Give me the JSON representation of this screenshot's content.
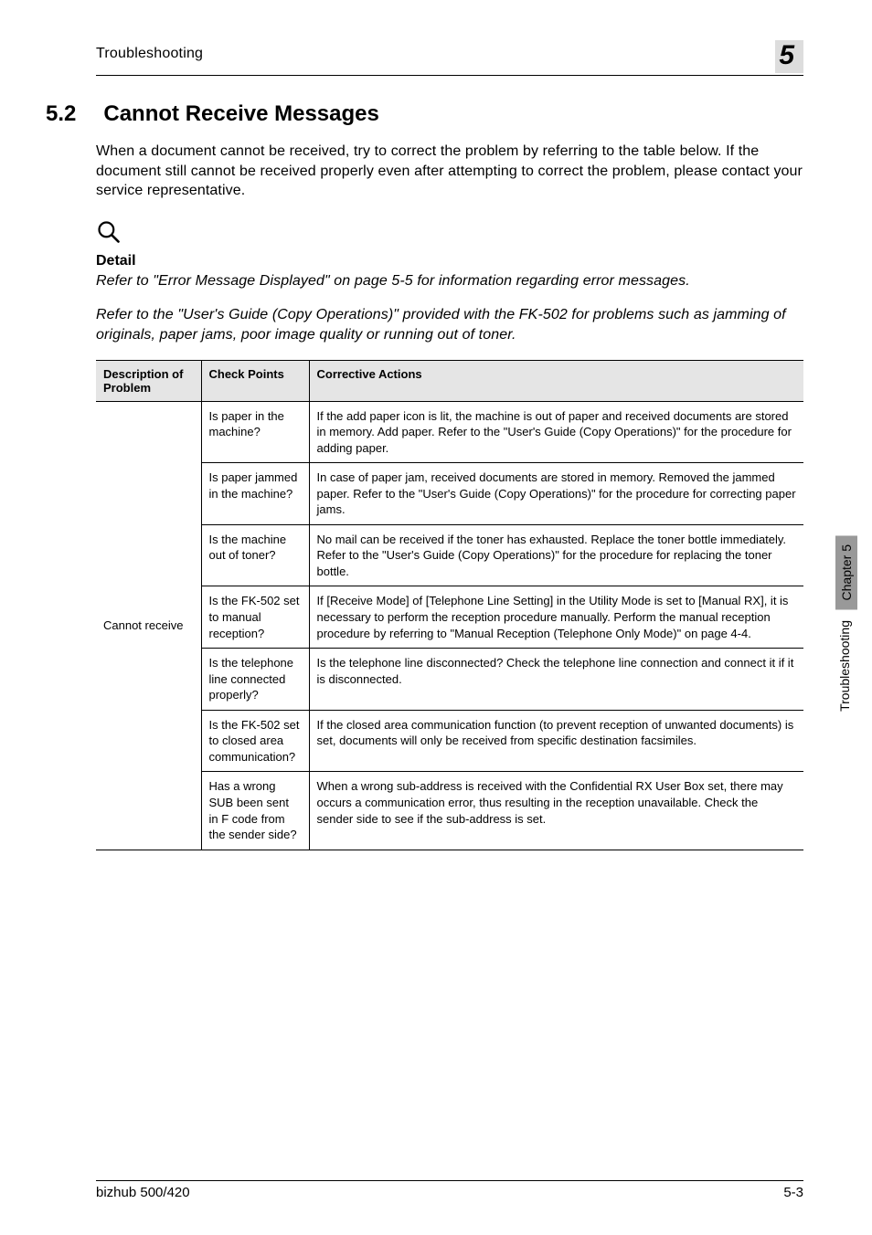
{
  "header": {
    "title": "Troubleshooting",
    "chapter_num": "5"
  },
  "section": {
    "num": "5.2",
    "title": "Cannot Receive Messages"
  },
  "intro": "When a document cannot be received, try to correct the problem by referring to the table below. If the document still cannot be received properly even after attempting to correct the problem, please contact your service representative.",
  "detail": {
    "heading": "Detail",
    "para1": "Refer to \"Error Message Displayed\" on page 5-5 for information regarding error messages.",
    "para2": "Refer to the \"User's Guide (Copy Operations)\" provided with the FK-502 for problems such as jamming of originals, paper jams, poor image quality or running out of toner."
  },
  "table": {
    "headers": {
      "desc": "Description of Problem",
      "check": "Check Points",
      "action": "Corrective Actions"
    },
    "row_desc": "Cannot receive",
    "rows": [
      {
        "check": "Is paper in the machine?",
        "action": "If the add paper icon is lit, the machine is out of paper and received documents are stored in memory. Add paper. Refer to the \"User's Guide (Copy Operations)\" for the procedure for adding paper."
      },
      {
        "check": "Is paper jammed in the machine?",
        "action": "In case of paper jam, received documents are stored in memory. Removed the jammed paper. Refer to the \"User's Guide (Copy Operations)\" for the procedure for correcting paper jams."
      },
      {
        "check": "Is the machine out of toner?",
        "action": "No mail can be received if the toner has exhausted. Replace the toner bottle immediately. Refer to the \"User's Guide (Copy Operations)\" for the procedure for replacing the toner bottle."
      },
      {
        "check": "Is the FK-502 set to manual reception?",
        "action": "If [Receive Mode] of [Telephone Line Setting] in the Utility Mode is set to [Manual RX], it is necessary to perform the reception procedure manually. Perform the manual reception procedure by referring to \"Manual Reception (Telephone Only Mode)\" on page 4-4."
      },
      {
        "check": "Is the telephone line connected properly?",
        "action": "Is the telephone line disconnected? Check the telephone line connection and connect it if it is disconnected."
      },
      {
        "check": "Is the FK-502 set to closed area communication?",
        "action": "If the closed area communication function (to prevent reception of unwanted documents) is set, documents will only be received from specific destination facsimiles."
      },
      {
        "check": "Has a wrong SUB been sent in F code from the sender side?",
        "action": "When a wrong sub-address is received with the Confidential RX User Box set, there may occurs a communication error, thus resulting in the reception unavailable. Check the sender side to see if the sub-address is set."
      }
    ]
  },
  "side": {
    "chapter": "Chapter 5",
    "label": "Troubleshooting"
  },
  "footer": {
    "left": "bizhub 500/420",
    "right": "5-3"
  }
}
